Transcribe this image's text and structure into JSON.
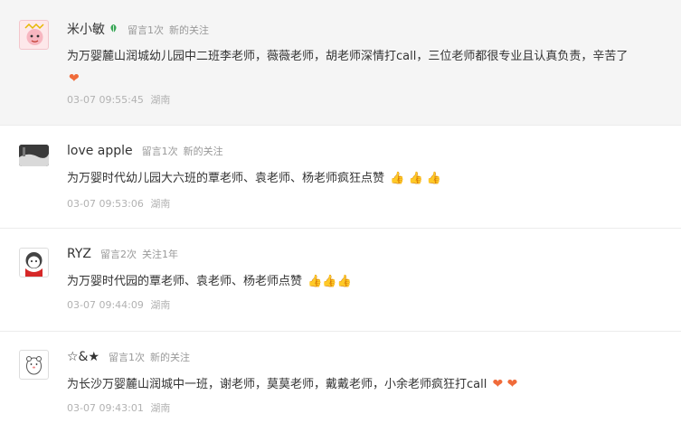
{
  "comments": [
    {
      "nickname": "米小敏",
      "nick_icon": "leaf-icon",
      "badge1": "留言1次",
      "badge2": "新的关注",
      "text": "为万婴麓山润城幼儿园中二班李老师，薇薇老师，胡老师深情打call，三位老师都很专业且认真负责，辛苦了",
      "emoji": "❤",
      "date": "03-07 09:55:45",
      "location": "湖南"
    },
    {
      "nickname": "love apple",
      "badge1": "留言1次",
      "badge2": "新的关注",
      "text": "为万婴时代幼儿园大六班的覃老师、袁老师、杨老师疯狂点赞",
      "emoji": "👍 👍 👍",
      "date": "03-07 09:53:06",
      "location": "湖南"
    },
    {
      "nickname": "RYZ",
      "badge1": "留言2次",
      "badge2": "关注1年",
      "text": "为万婴时代园的覃老师、袁老师、杨老师点赞",
      "emoji": "👍👍👍",
      "date": "03-07 09:44:09",
      "location": "湖南"
    },
    {
      "nickname": "☆&★",
      "badge1": "留言1次",
      "badge2": "新的关注",
      "text": "为长沙万婴麓山润城中一班，谢老师，莫莫老师，戴戴老师，小余老师疯狂打call",
      "emoji": "❤ ❤",
      "date": "03-07 09:43:01",
      "location": "湖南"
    }
  ],
  "colors": {
    "highlight_bg": "#f5f5f5",
    "time_text": "#b2b2b2",
    "badge_text": "#999999",
    "heart": "#f06b3a",
    "thumb": "#f0b43c"
  }
}
